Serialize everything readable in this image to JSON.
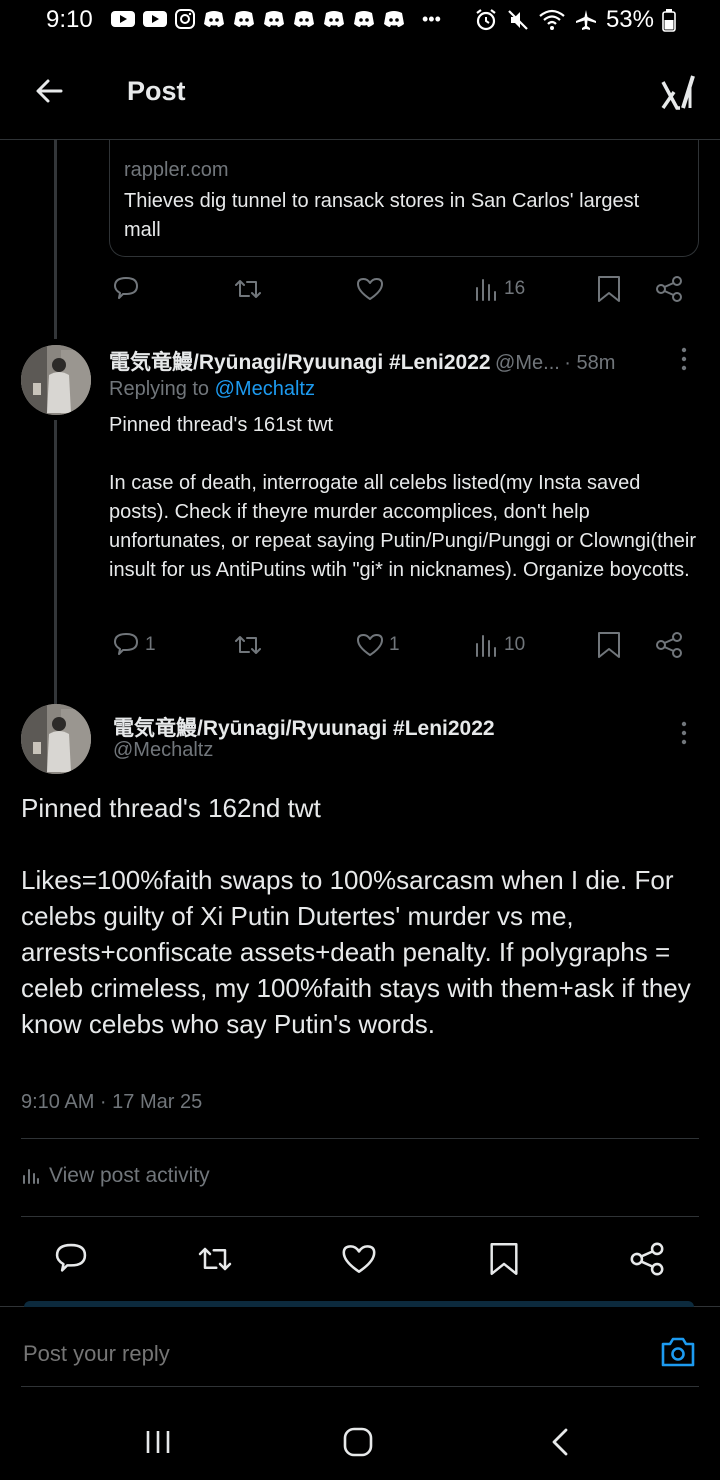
{
  "status_bar": {
    "time": "9:10",
    "battery": "53%",
    "overflow": "•••"
  },
  "header": {
    "title": "Post",
    "logo": "Grok"
  },
  "link_card": {
    "domain": "rappler.com",
    "title": "Thieves dig tunnel to ransack stores in San Carlos' largest mall"
  },
  "card_actions": {
    "views": "16"
  },
  "reply": {
    "name": "電気竜鰻/Ryūnagi/Ryuunagi #Leni2022",
    "handle": "@Me...",
    "time": "· 58m",
    "replying_prefix": "Replying to ",
    "replying_to": "@Mechaltz",
    "text": "Pinned thread's 161st twt\n\nIn case of death, interrogate all celebs listed(my Insta saved posts). Check if theyre murder accomplices, don't help unfortunates, or repeat saying Putin/Pungi/Punggi or Clowngi(their insult for us AntiPutins wtih \"gi* in nicknames). Organize boycotts.",
    "replies": "1",
    "likes": "1",
    "views": "10"
  },
  "main_post": {
    "name": "電気竜鰻/Ryūnagi/Ryuunagi #Leni2022",
    "handle": "@Mechaltz",
    "text": "Pinned thread's 162nd twt\n\nLikes=100%faith swaps to 100%sarcasm when I die. For celebs guilty of Xi Putin Dutertes' murder vs me, arrests+confiscate assets+death penalty. If polygraphs = celeb crimeless, my 100%faith stays with them+ask if they know celebs who say Putin's words.",
    "timestamp": "9:10 AM · 17 Mar 25",
    "view_activity": "View post activity"
  },
  "reply_bar": {
    "placeholder": "Post your reply"
  },
  "colors": {
    "accent": "#1d9bf0",
    "muted": "#71767b",
    "border": "#2f3336"
  }
}
